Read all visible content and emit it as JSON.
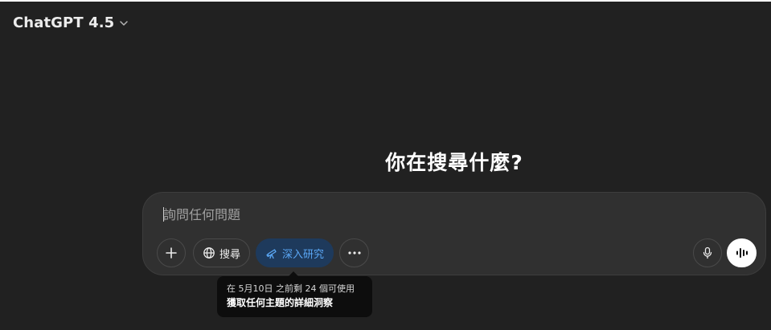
{
  "header": {
    "model_name": "ChatGPT 4.5"
  },
  "main": {
    "headline": "你在搜尋什麼?"
  },
  "composer": {
    "placeholder": "詢問任何問題",
    "value": "",
    "buttons": {
      "search_label": "搜尋",
      "deep_research_label": "深入研究"
    }
  },
  "tooltip": {
    "line1": "在 5月10日 之前剩 24 個可使用",
    "line2": "獲取任何主題的詳細洞察"
  },
  "icons": {
    "model_dropdown": "chevron-down-icon",
    "add": "plus-icon",
    "search": "globe-icon",
    "deep_research": "telescope-icon",
    "more": "more-horizontal-icon",
    "mic": "microphone-icon",
    "voice": "voice-wave-icon"
  },
  "colors": {
    "background": "#212121",
    "composer": "#303030",
    "accent": "#5aa7f5",
    "accent_bg": "#1e3a5c"
  }
}
